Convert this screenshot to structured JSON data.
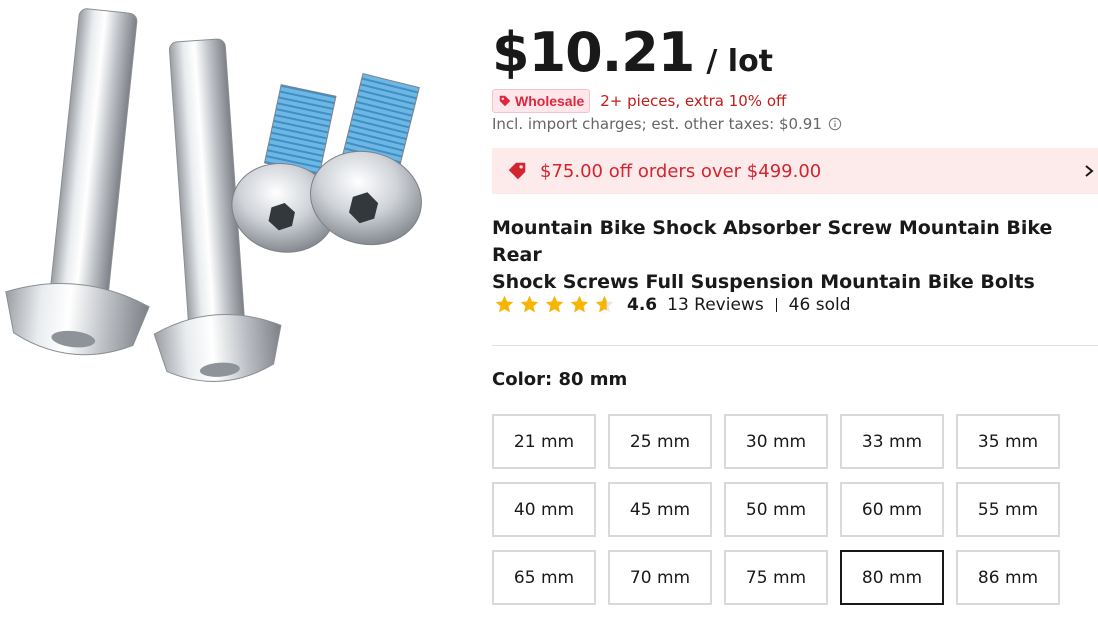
{
  "price": {
    "amount": "$10.21",
    "unit": "/ lot"
  },
  "wholesale": {
    "badge_label": "Wholesale",
    "text": "2+ pieces, extra 10% off"
  },
  "tax_note": "Incl. import charges; est. other taxes: $0.91",
  "coupon": {
    "text": "$75.00 off orders over $499.00"
  },
  "product": {
    "title_line1": "Mountain Bike Shock Absorber Screw Mountain Bike Rear",
    "title_line2": "Shock Screws Full Suspension Mountain Bike Bolts"
  },
  "rating": {
    "value": "4.6",
    "stars": 4.6,
    "reviews": "13 Reviews",
    "sold": "46 sold"
  },
  "color": {
    "label": "Color: 80 mm",
    "selected": "80 mm"
  },
  "sizes": [
    "21 mm",
    "25 mm",
    "30 mm",
    "33 mm",
    "35 mm",
    "40 mm",
    "45 mm",
    "50 mm",
    "60 mm",
    "55 mm",
    "65 mm",
    "70 mm",
    "75 mm",
    "80 mm",
    "86 mm"
  ],
  "colors": {
    "accent_red": "#d4242f",
    "star": "#f7b500",
    "selected_border": "#191919"
  },
  "icons": {
    "wholesale": "tag-icon",
    "coupon": "coupon-tag-icon",
    "info": "info-icon",
    "chevron": "chevron-right-icon",
    "star": "star-icon"
  }
}
